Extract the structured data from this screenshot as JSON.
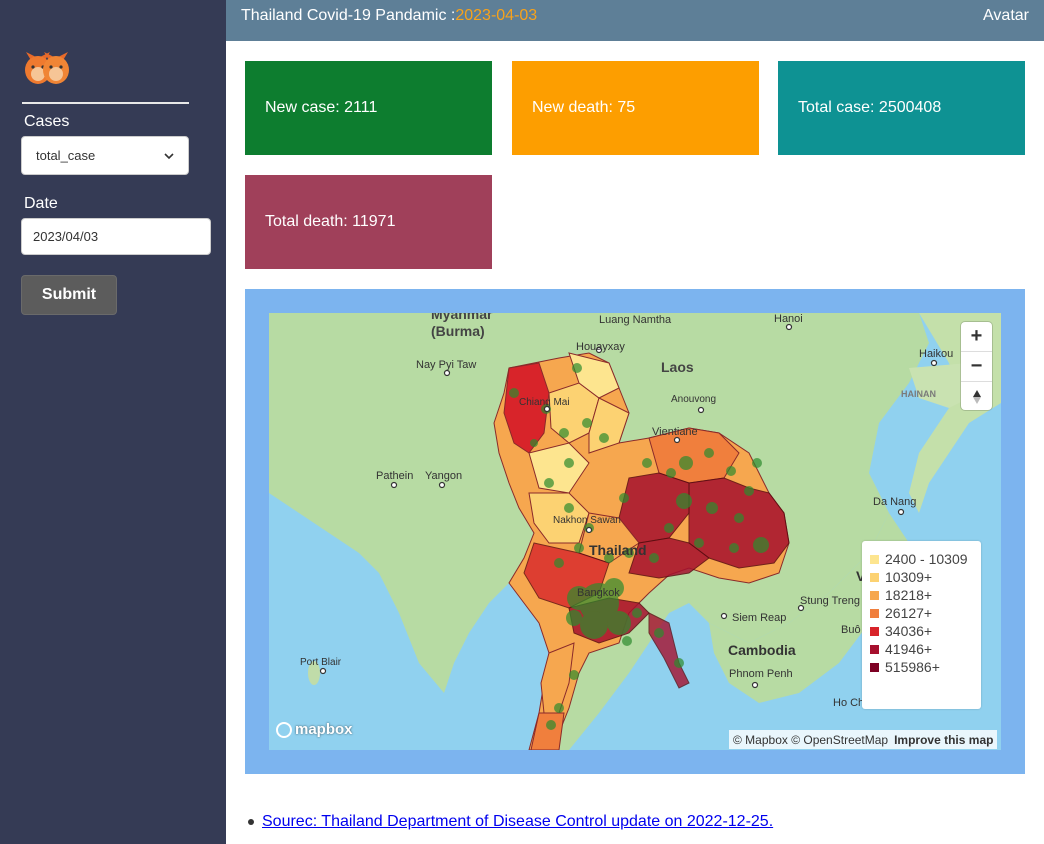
{
  "topbar": {
    "title_prefix": "Thailand Covid-19 Pandamic :",
    "title_date": "2023-04-03",
    "avatar": "Avatar"
  },
  "sidebar": {
    "logo_icon": "cats-logo-icon",
    "cases_label": "Cases",
    "cases_selected": "total_case",
    "date_label": "Date",
    "date_value": "2023/04/03",
    "submit_label": "Submit"
  },
  "cards": {
    "new_case": "New case: 2111",
    "new_death": "New death: 75",
    "total_case": "Total case: 2500408",
    "total_death": "Total death: 11971"
  },
  "colors": {
    "card_new_case": "#0d7d2f",
    "card_new_death": "#fd9e00",
    "card_total_case": "#0e9293",
    "card_total_death": "#a0405a",
    "header": "#5e7f97",
    "sidebar": "#353b55"
  },
  "map": {
    "place_labels": {
      "myanmar": "Myanmar",
      "burma": "(Burma)",
      "luang_namtha": "Luang Namtha",
      "hanoi": "Hanoi",
      "houayxay": "Houayxay",
      "nay_pyi_taw": "Nay Pyi Taw",
      "laos": "Laos",
      "haikou": "Haikou",
      "chiang_mai": "Chiang Mai",
      "anouvong": "Anouvong",
      "hainan": "HAINAN",
      "vientiane": "Vientiane",
      "pathein": "Pathein",
      "yangon": "Yangon",
      "da_nang": "Da Nang",
      "nakhon_sawan": "Nakhon Sawan",
      "thailand": "Thailand",
      "bangkok": "Bangkok",
      "siem_reap": "Siem Reap",
      "stung_treng": "Stung Treng",
      "buon": "Buô",
      "port_blair": "Port Blair",
      "cambodia": "Cambodia",
      "phnom_penh": "Phnom Penh",
      "ho_chi": "Ho Ch",
      "v_label": "V"
    },
    "legend": [
      {
        "label": "2400 - 10309",
        "color": "#fde58f"
      },
      {
        "label": "10309+",
        "color": "#fcd272"
      },
      {
        "label": "18218+",
        "color": "#f6a74f"
      },
      {
        "label": "26127+",
        "color": "#f07f3d"
      },
      {
        "label": "34036+",
        "color": "#d8242a"
      },
      {
        "label": "41946+",
        "color": "#a6102e"
      },
      {
        "label": "515986+",
        "color": "#7d0023"
      }
    ],
    "mapbox_logo": "mapbox",
    "attribution": "© Mapbox © OpenStreetMap",
    "improve": "Improve this map"
  },
  "source": {
    "link": "Sourec: Thailand Department of Disease Control update on 2022-12-25."
  }
}
